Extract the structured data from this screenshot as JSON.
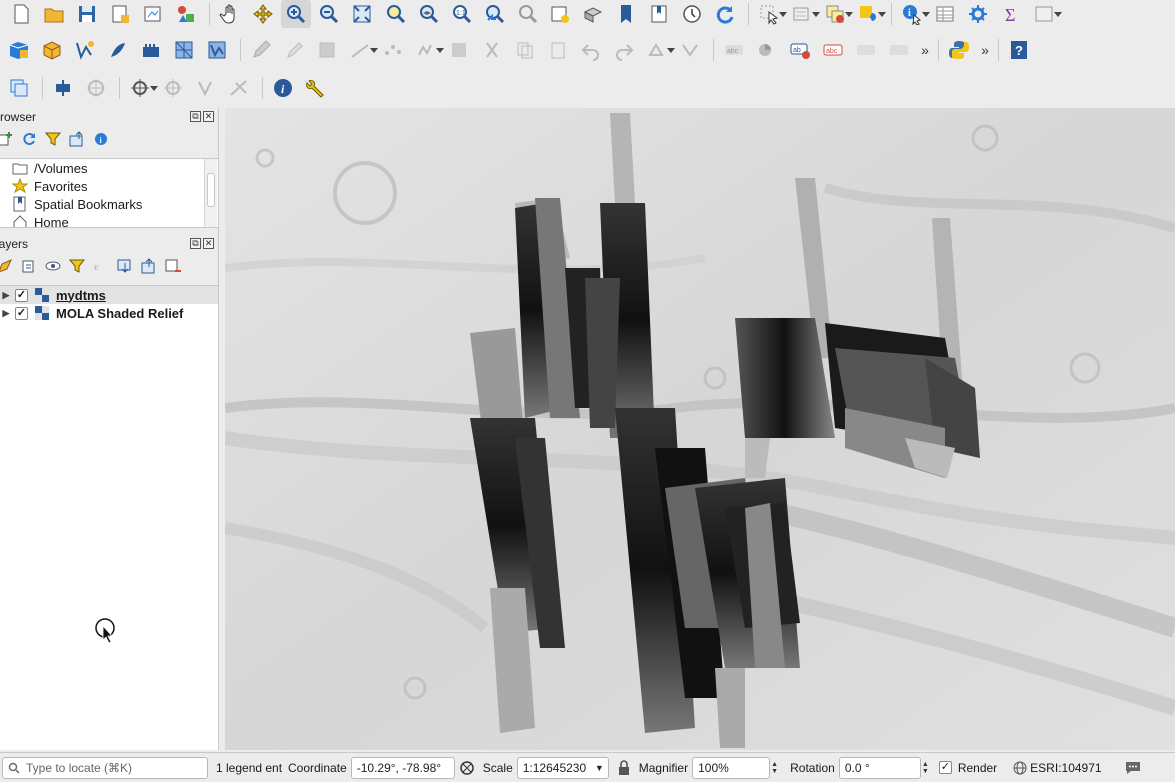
{
  "colors": {
    "toolbar_bg": "#ececec",
    "accent_blue": "#2a7ad8",
    "map_relief": "#dcdcdc"
  },
  "browser_panel": {
    "title": "Browser",
    "items": [
      {
        "label": "/Volumes",
        "icon": "folder-icon"
      },
      {
        "label": "Favorites",
        "icon": "star-icon"
      },
      {
        "label": "Spatial Bookmarks",
        "icon": "bookmark-icon"
      },
      {
        "label": "Home",
        "icon": "home-icon"
      }
    ]
  },
  "layers_panel": {
    "title": "Layers",
    "layers": [
      {
        "label": "mydtms",
        "checked": true,
        "selected": true
      },
      {
        "label": "MOLA Shaded Relief",
        "checked": true,
        "selected": false
      }
    ]
  },
  "statusbar": {
    "locate_placeholder": "Type to locate (⌘K)",
    "legend_text": "1 legend ent",
    "coordinate_label": "Coordinate",
    "coordinate_value": "-10.29°, -78.98°",
    "scale_label": "Scale",
    "scale_value": "1:12645230",
    "magnifier_label": "Magnifier",
    "magnifier_value": "100%",
    "rotation_label": "Rotation",
    "rotation_value": "0.0 °",
    "render_label": "Render",
    "render_checked": true,
    "crs_value": "ESRI:104971"
  }
}
